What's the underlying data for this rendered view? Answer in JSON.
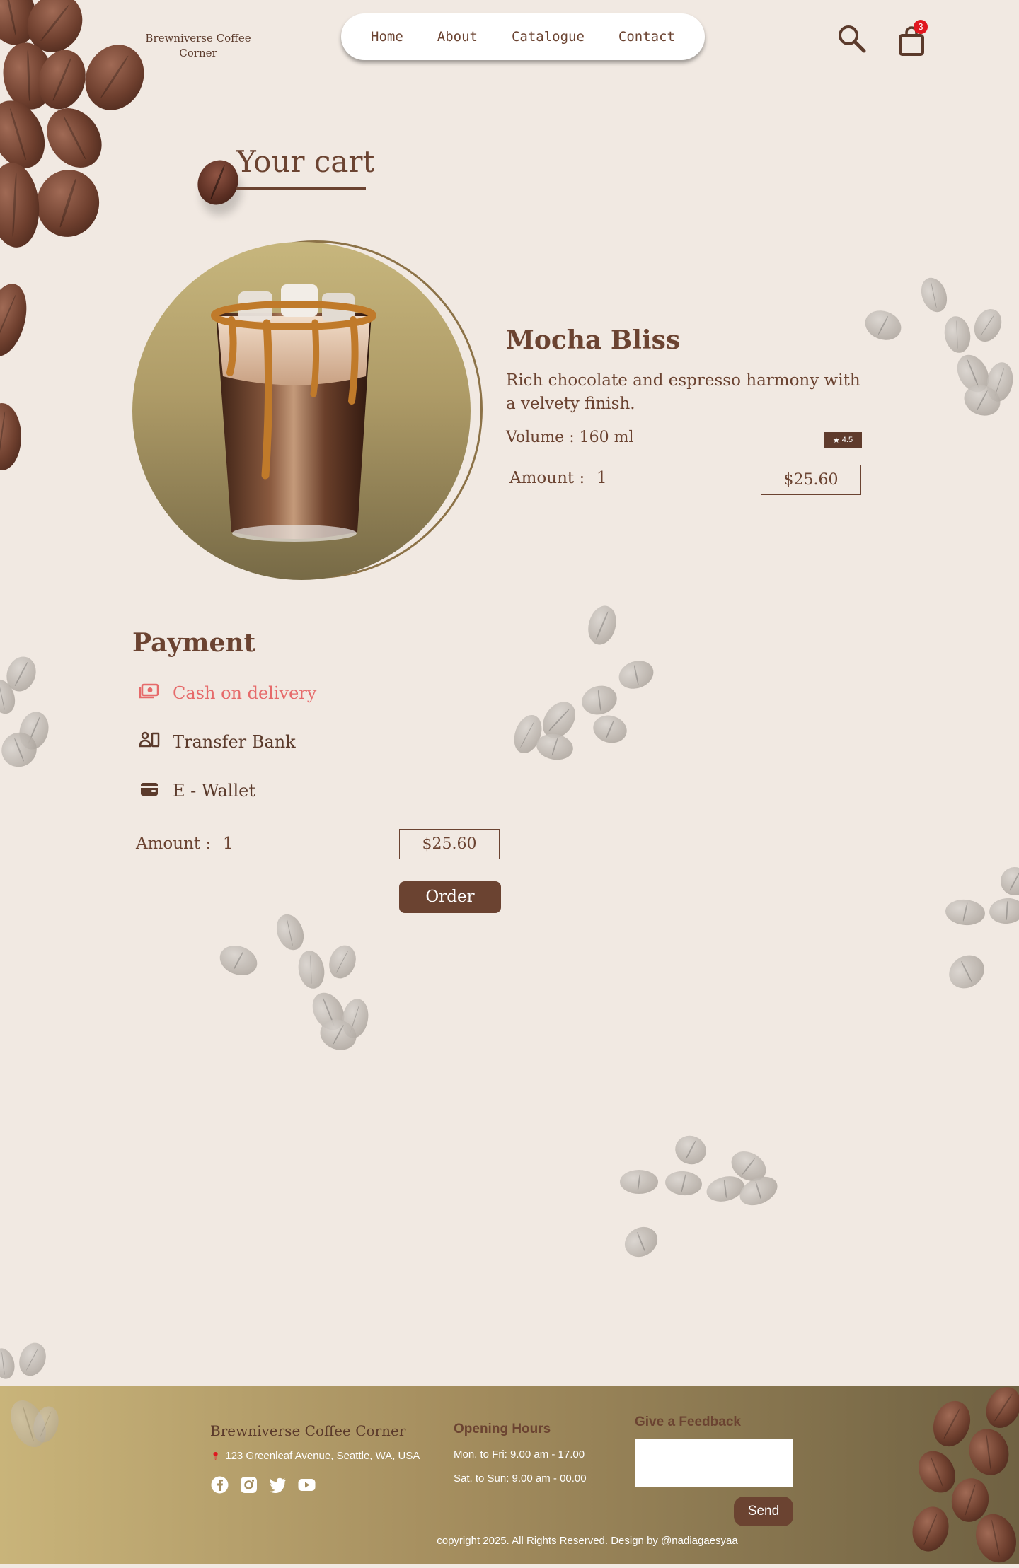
{
  "brand": {
    "name": "Brewniverse Coffee Corner"
  },
  "nav": {
    "items": [
      "Home",
      "About",
      "Catalogue",
      "Contact"
    ]
  },
  "header": {
    "search_icon": "search-icon",
    "cart_icon": "shopping-bag-icon",
    "cart_count": "3"
  },
  "cart": {
    "title": "Your cart"
  },
  "product": {
    "name": "Mocha Bliss",
    "description": "Rich chocolate and espresso harmony with a velvety finish.",
    "volume": "Volume : 160 ml",
    "rating": "4.5",
    "amount_label": "Amount :",
    "amount": "1",
    "price": "$25.60",
    "image": "iced-mocha-drink"
  },
  "payment": {
    "title": "Payment",
    "options": [
      {
        "label": "Cash on delivery",
        "icon": "cash-icon",
        "selected": true,
        "color": "#e66a6a"
      },
      {
        "label": "Transfer Bank",
        "icon": "bank-transfer-icon",
        "selected": false
      },
      {
        "label": "E - Wallet",
        "icon": "wallet-icon",
        "selected": false
      }
    ],
    "amount_label": "Amount :",
    "amount": "1",
    "price": "$25.60",
    "order_label": "Order"
  },
  "footer": {
    "brand": "Brewniverse Coffee Corner",
    "address": "123 Greenleaf Avenue, Seattle, WA, USA",
    "social": [
      "facebook-icon",
      "instagram-icon",
      "twitter-icon",
      "youtube-icon"
    ],
    "hours_title": "Opening Hours",
    "hours": [
      "Mon. to Fri: 9.00 am - 17.00",
      "Sat. to Sun: 9.00 am - 00.00"
    ],
    "feedback_title": "Give a Feedback",
    "send_label": "Send",
    "copyright": "copyright 2025. All Rights Reserved. Design by @nadiagaesyaa"
  },
  "colors": {
    "brand_brown": "#6b4331",
    "background": "#f1e9e2",
    "accent_red": "#e66a6a",
    "badge_red": "#e0171f"
  }
}
